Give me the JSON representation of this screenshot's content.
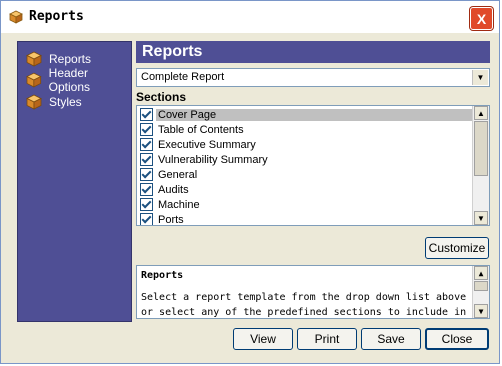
{
  "window": {
    "title": "Reports",
    "close_label": "X"
  },
  "sidebar": {
    "items": [
      {
        "label": "Reports",
        "icon": "report-box-icon"
      },
      {
        "label": "Header Options",
        "icon": "report-box-icon"
      },
      {
        "label": "Styles",
        "icon": "report-box-icon"
      }
    ]
  },
  "main": {
    "header": "Reports",
    "template": {
      "selected": "Complete Report"
    },
    "sections_label": "Sections",
    "sections": [
      {
        "label": "Cover Page",
        "checked": true,
        "selected": true
      },
      {
        "label": "Table of Contents",
        "checked": true
      },
      {
        "label": "Executive Summary",
        "checked": true
      },
      {
        "label": "Vulnerability Summary",
        "checked": true
      },
      {
        "label": "General",
        "checked": true
      },
      {
        "label": "Audits",
        "checked": true
      },
      {
        "label": "Machine",
        "checked": true
      },
      {
        "label": "Ports",
        "checked": true
      }
    ],
    "customize_label": "Customize",
    "description": {
      "title": "Reports",
      "text": "Select a report template from the drop down list above or select any of the predefined sections to include in"
    }
  },
  "buttons": {
    "view": "View",
    "print": "Print",
    "save": "Save",
    "close": "Close"
  },
  "colors": {
    "sidebar": "#4f4f95",
    "header": "#4f4f95",
    "close_button": "#e04a2a"
  }
}
